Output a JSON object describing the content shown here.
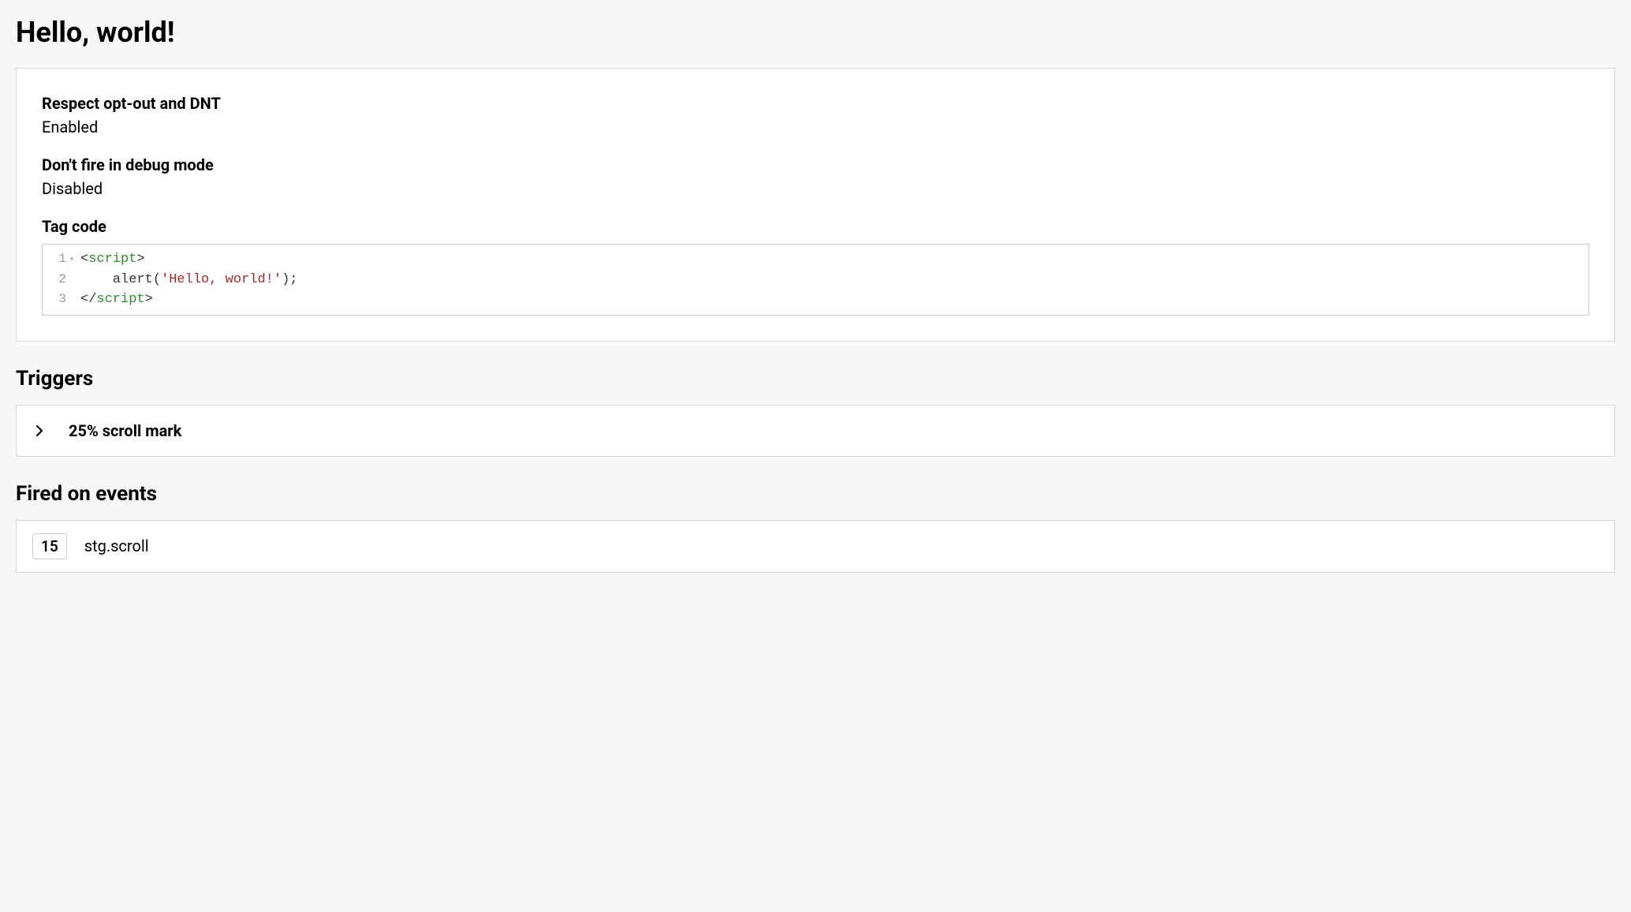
{
  "page_title": "Hello, world!",
  "settings": {
    "respect_optout": {
      "label": "Respect opt-out and DNT",
      "value": "Enabled"
    },
    "debug_mode": {
      "label": "Don't fire in debug mode",
      "value": "Disabled"
    },
    "tag_code": {
      "label": "Tag code",
      "lines": [
        {
          "n": "1",
          "fold": "▾",
          "tokens": [
            {
              "t": "<",
              "c": "bracket"
            },
            {
              "t": "script",
              "c": "tag"
            },
            {
              "t": ">",
              "c": "bracket"
            }
          ]
        },
        {
          "n": "2",
          "fold": "",
          "tokens": [
            {
              "t": "    alert",
              "c": "func"
            },
            {
              "t": "(",
              "c": "punc"
            },
            {
              "t": "'Hello, world!'",
              "c": "string"
            },
            {
              "t": ");",
              "c": "punc"
            }
          ]
        },
        {
          "n": "3",
          "fold": "",
          "tokens": [
            {
              "t": "</",
              "c": "bracket"
            },
            {
              "t": "script",
              "c": "tag"
            },
            {
              "t": ">",
              "c": "bracket"
            }
          ]
        }
      ]
    }
  },
  "triggers": {
    "heading": "Triggers",
    "items": [
      {
        "name": "25% scroll mark"
      }
    ]
  },
  "fired_events": {
    "heading": "Fired on events",
    "items": [
      {
        "count": "15",
        "name": "stg.scroll"
      }
    ]
  }
}
